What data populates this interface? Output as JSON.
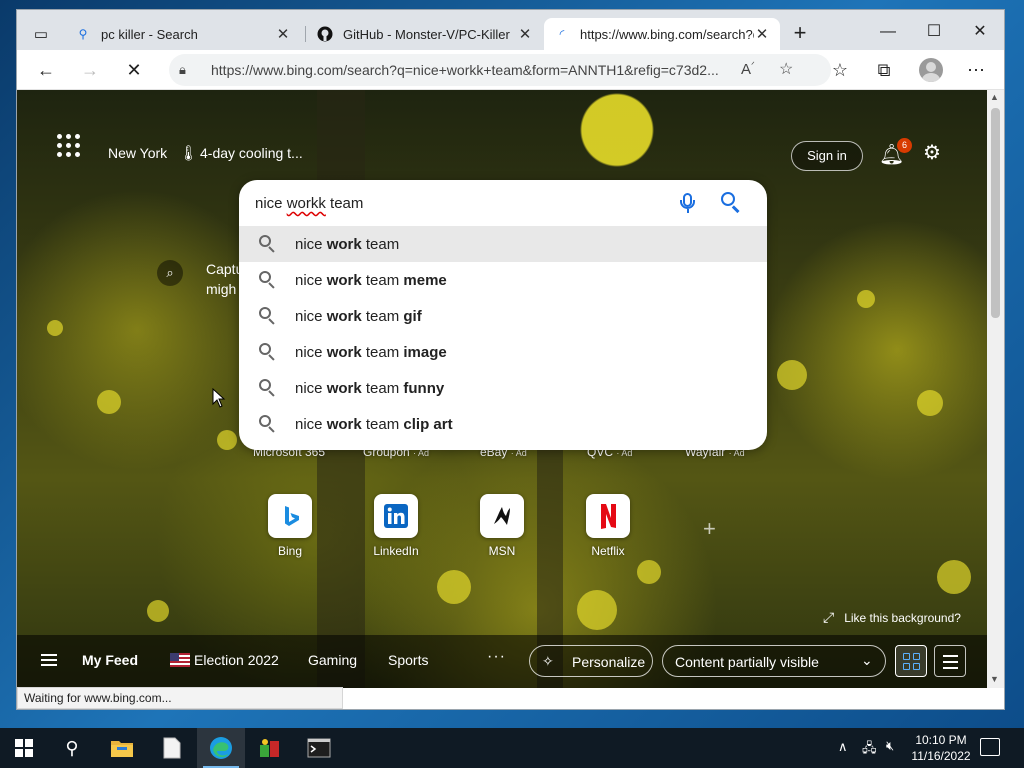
{
  "browser": {
    "tabs": [
      {
        "label": "pc killer - Search",
        "favicon": "search-icon"
      },
      {
        "label": "GitHub - Monster-V/PC-Killer",
        "favicon": "github-icon"
      },
      {
        "label": "https://www.bing.com/search?q",
        "favicon": "loading-spinner-icon"
      }
    ],
    "url": "https://www.bing.com/search?q=nice+workk+team&form=ANNTH1&refig=c73d2...",
    "status_text": "Waiting for www.bing.com..."
  },
  "bing": {
    "location": "New York",
    "weather": "4-day cooling t...",
    "sign_in": "Sign in",
    "notification_count": "6",
    "search": {
      "query_prefix": "nice ",
      "query_misspelled": "workk",
      "query_suffix": " team",
      "suggestions": [
        {
          "prefix": "nice ",
          "bold1": "work",
          "mid": " team",
          "bold2": ""
        },
        {
          "prefix": "nice ",
          "bold1": "work",
          "mid": " team ",
          "bold2": "meme"
        },
        {
          "prefix": "nice ",
          "bold1": "work",
          "mid": " team ",
          "bold2": "gif"
        },
        {
          "prefix": "nice ",
          "bold1": "work",
          "mid": " team ",
          "bold2": "image"
        },
        {
          "prefix": "nice ",
          "bold1": "work",
          "mid": " team ",
          "bold2": "funny"
        },
        {
          "prefix": "nice ",
          "bold1": "work",
          "mid": " team ",
          "bold2": "clip art"
        }
      ]
    },
    "caption": {
      "line1": "Captu",
      "line2": "migh"
    },
    "quicklinks": [
      {
        "label": "Microsoft 365",
        "ad": ""
      },
      {
        "label": "Groupon",
        "ad": "· Ad"
      },
      {
        "label": "eBay",
        "ad": "· Ad"
      },
      {
        "label": "QVC",
        "ad": "· Ad"
      },
      {
        "label": "Wayfair",
        "ad": "· Ad"
      }
    ],
    "tiles": [
      {
        "label": "Bing",
        "icon": "bing-icon"
      },
      {
        "label": "LinkedIn",
        "icon": "linkedin-icon"
      },
      {
        "label": "MSN",
        "icon": "msn-icon"
      },
      {
        "label": "Netflix",
        "icon": "netflix-icon"
      }
    ],
    "like_background": "Like this background?",
    "feed": {
      "my_feed": "My Feed",
      "election": "Election 2022",
      "gaming": "Gaming",
      "sports": "Sports",
      "more": "···",
      "personalize": "Personalize",
      "content_visibility": "Content partially visible"
    }
  },
  "taskbar": {
    "time": "10:10 PM",
    "date": "11/16/2022"
  },
  "colors": {
    "accent": "#1a6ee0",
    "badge": "#d83b01",
    "taskbar": "#0f1a24"
  }
}
